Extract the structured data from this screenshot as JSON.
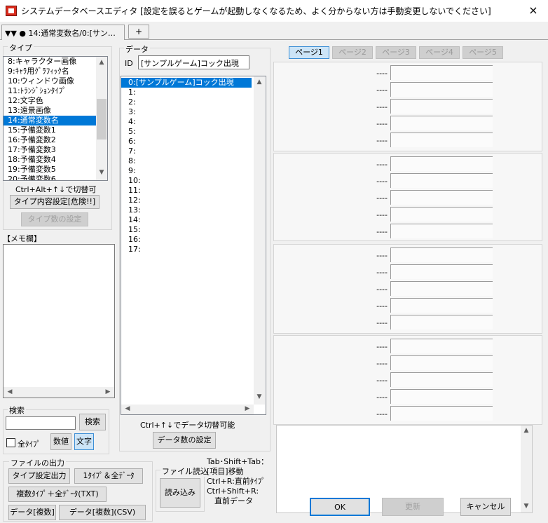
{
  "window": {
    "title": "システムデータベースエディタ [設定を誤るとゲームが起動しなくなるため、よく分からない方は手動変更しないでください]",
    "close_icon": "×"
  },
  "tabs": {
    "current": "▼▼ ● 14:通常変数名/0:[サン…",
    "add": "+"
  },
  "type_panel": {
    "label": "タイプ",
    "items": [
      "8:キャラクター画像",
      "9:ｷｬﾗ用ｸﾞﾗﾌｨｯｸ名",
      "10:ウィンドウ画像",
      "11:ﾄﾗﾝｼﾞｼｮﾝﾀｲﾌﾟ",
      "12:文字色",
      "13:遠景画像",
      "14:通常変数名",
      "15:予備変数1",
      "16:予備変数2",
      "17:予備変数3",
      "18:予備変数4",
      "19:予備変数5",
      "20:予備変数6"
    ],
    "selected_index": 6,
    "hint": "Ctrl+Alt+↑↓で切替可",
    "settings_button": "タイプ内容設定[危険!!]",
    "count_button": "タイプ数の設定"
  },
  "memo": {
    "label": "【メモ欄】"
  },
  "search": {
    "label": "検索",
    "button": "検索",
    "all_types": "全ﾀｲﾌﾟ",
    "numeric": "数値",
    "text": "文字"
  },
  "file_output": {
    "label": "ファイルの出力",
    "type_settings": "タイプ設定出力",
    "one_type_all": "1ﾀｲﾌﾟ＆全ﾃﾞｰﾀ",
    "multi_type_txt": "複数ﾀｲﾌﾟ＋全ﾃﾞｰﾀ(TXT)",
    "data_multi": "データ[複数]",
    "data_multi_csv": "データ[複数](CSV)"
  },
  "file_read": {
    "label": "ファイル読込",
    "button": "読み込み"
  },
  "shortcuts": {
    "line1": "Tab･Shift+Tab：",
    "line2": "[項目]移動",
    "line3": "Ctrl+R:直前ﾀｲﾌﾟ",
    "line4": "Ctrl+Shift+R:",
    "line5": "　直前データ"
  },
  "data_panel": {
    "label": "データ",
    "id_label": "ID",
    "id_value": "[サンプルゲーム]コック出現",
    "items": [
      "0:[サンプルゲーム]コック出現",
      "1:",
      "2:",
      "3:",
      "4:",
      "5:",
      "6:",
      "7:",
      "8:",
      "9:",
      "10:",
      "11:",
      "12:",
      "13:",
      "14:",
      "15:",
      "16:",
      "17:"
    ],
    "selected_index": 0,
    "hint": "Ctrl+↑↓でデータ切替可能",
    "count_button": "データ数の設定"
  },
  "pages": {
    "tabs": [
      "ページ1",
      "ページ2",
      "ページ3",
      "ページ4",
      "ページ5"
    ],
    "active_index": 0,
    "field_label": "----"
  },
  "footer": {
    "ok": "OK",
    "update": "更新",
    "cancel": "キャンセル"
  },
  "colors": {
    "selection": "#0078d7",
    "page_active": "#cce4f7",
    "app_icon": "#d92b1c"
  }
}
